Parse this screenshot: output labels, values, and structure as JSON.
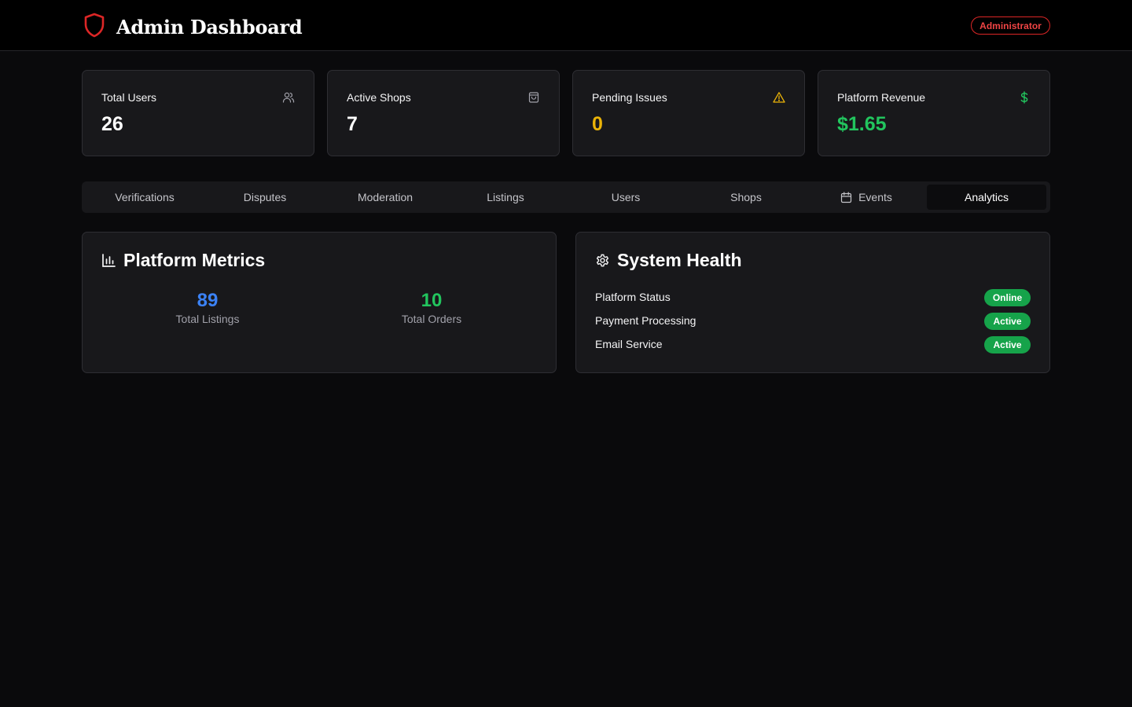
{
  "header": {
    "title": "Admin Dashboard",
    "role_badge": "Administrator",
    "logo_icon": "shield-icon"
  },
  "stats": [
    {
      "label": "Total Users",
      "value": "26",
      "icon": "users-icon",
      "value_color": "#ffffff"
    },
    {
      "label": "Active Shops",
      "value": "7",
      "icon": "shopping-bag-icon",
      "value_color": "#ffffff"
    },
    {
      "label": "Pending Issues",
      "value": "0",
      "icon": "alert-triangle-icon",
      "value_color": "#eab308"
    },
    {
      "label": "Platform Revenue",
      "value": "$1.65",
      "icon": "dollar-icon",
      "value_color": "#22c55e"
    }
  ],
  "tabs": [
    {
      "label": "Verifications"
    },
    {
      "label": "Disputes"
    },
    {
      "label": "Moderation"
    },
    {
      "label": "Listings"
    },
    {
      "label": "Users"
    },
    {
      "label": "Shops"
    },
    {
      "label": "Events",
      "icon": "calendar-icon"
    },
    {
      "label": "Analytics",
      "active": true
    }
  ],
  "metrics": {
    "title": "Platform Metrics",
    "icon": "bar-chart-icon",
    "items": [
      {
        "value": "89",
        "label": "Total Listings",
        "color": "#3b82f6"
      },
      {
        "value": "10",
        "label": "Total Orders",
        "color": "#22c55e"
      }
    ]
  },
  "health": {
    "title": "System Health",
    "icon": "gear-icon",
    "items": [
      {
        "label": "Platform Status",
        "status": "Online"
      },
      {
        "label": "Payment Processing",
        "status": "Active"
      },
      {
        "label": "Email Service",
        "status": "Active"
      }
    ]
  },
  "colors": {
    "accent_red": "#dc2626",
    "status_green": "#16a34a",
    "warning_yellow": "#eab308",
    "metric_blue": "#3b82f6"
  }
}
